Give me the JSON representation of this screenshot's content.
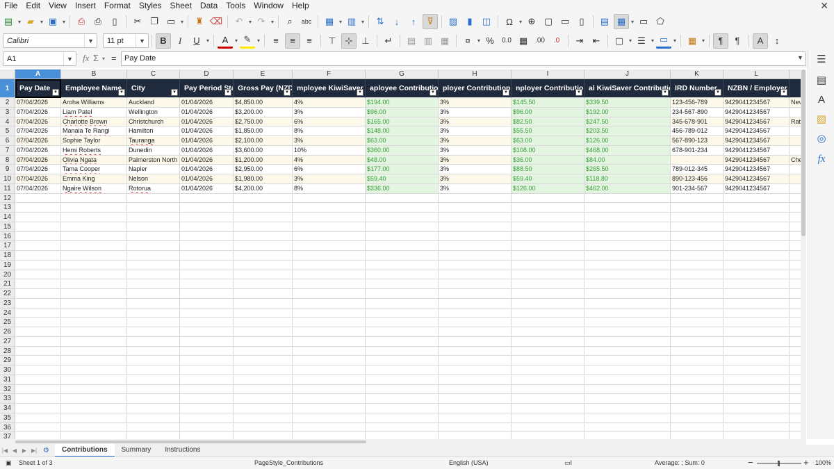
{
  "menu": [
    "File",
    "Edit",
    "View",
    "Insert",
    "Format",
    "Styles",
    "Sheet",
    "Data",
    "Tools",
    "Window",
    "Help"
  ],
  "font": {
    "name": "Calibri",
    "size": "11 pt"
  },
  "namebox": "A1",
  "formula": "Pay Date",
  "columns": [
    "A",
    "B",
    "C",
    "D",
    "E",
    "F",
    "G",
    "H",
    "I",
    "J",
    "K",
    "L"
  ],
  "headers": [
    "Pay Date",
    "Employee Name",
    "City",
    "Pay Period Start",
    "Gross Pay (NZD)",
    "mployee KiwiSaver Rate",
    "aployee Contribution (N",
    "ployer Contribution Rat",
    "nployer Contribution (N",
    "al KiwiSaver Contribution (N",
    "IRD Number",
    "NZBN / Employer ID"
  ],
  "rows": [
    [
      "07/04/2026",
      "Aroha Williams",
      "Auckland",
      "01/04/2026",
      "$4,850.00",
      "4%",
      "$194.00",
      "3%",
      "$145.50",
      "$339.50",
      "123-456-789",
      "9429041234567",
      "Nev"
    ],
    [
      "07/04/2026",
      "Liam Patel",
      "Wellington",
      "01/04/2026",
      "$3,200.00",
      "3%",
      "$96.00",
      "3%",
      "$96.00",
      "$192.00",
      "234-567-890",
      "9429041234567",
      ""
    ],
    [
      "07/04/2026",
      "Charlotte Brown",
      "Christchurch",
      "01/04/2026",
      "$2,750.00",
      "6%",
      "$165.00",
      "3%",
      "$82.50",
      "$247.50",
      "345-678-901",
      "9429041234567",
      "Rate"
    ],
    [
      "07/04/2026",
      "Manaia Te Rangi",
      "Hamilton",
      "01/04/2026",
      "$1,850.00",
      "8%",
      "$148.00",
      "3%",
      "$55.50",
      "$203.50",
      "456-789-012",
      "9429041234567",
      ""
    ],
    [
      "07/04/2026",
      "Sophie Taylor",
      "Tauranga",
      "01/04/2026",
      "$2,100.00",
      "3%",
      "$63.00",
      "3%",
      "$63.00",
      "$126.00",
      "567-890-123",
      "9429041234567",
      ""
    ],
    [
      "07/04/2026",
      "Hemi Roberts",
      "Dunedin",
      "01/04/2026",
      "$3,600.00",
      "10%",
      "$360.00",
      "3%",
      "$108.00",
      "$468.00",
      "678-901-234",
      "9429041234567",
      ""
    ],
    [
      "07/04/2026",
      "Olivia Ngata",
      "Palmerston North",
      "01/04/2026",
      "$1,200.00",
      "4%",
      "$48.00",
      "3%",
      "$36.00",
      "$84.00",
      "",
      "9429041234567",
      "Che"
    ],
    [
      "07/04/2026",
      "Tama Cooper",
      "Napier",
      "01/04/2026",
      "$2,950.00",
      "6%",
      "$177.00",
      "3%",
      "$88.50",
      "$265.50",
      "789-012-345",
      "9429041234567",
      ""
    ],
    [
      "07/04/2026",
      "Emma King",
      "Nelson",
      "01/04/2026",
      "$1,980.00",
      "3%",
      "$59.40",
      "3%",
      "$59.40",
      "$118.80",
      "890-123-456",
      "9429041234567",
      ""
    ],
    [
      "07/04/2026",
      "Ngaire Wilson",
      "Rotorua",
      "01/04/2026",
      "$4,200.00",
      "8%",
      "$336.00",
      "3%",
      "$126.00",
      "$462.00",
      "901-234-567",
      "9429041234567",
      ""
    ]
  ],
  "empty_row_numbers": [
    "12",
    "13",
    "14",
    "15",
    "16",
    "17",
    "18",
    "19",
    "20",
    "21",
    "22",
    "23",
    "24",
    "25",
    "26",
    "27",
    "28",
    "29",
    "30",
    "31",
    "32",
    "33",
    "34",
    "35",
    "36",
    "37"
  ],
  "sheets": [
    "Contributions",
    "Summary",
    "Instructions"
  ],
  "status": {
    "sheet": "Sheet 1 of 3",
    "page_style": "PageStyle_Contributions",
    "language": "English (USA)",
    "sum": "Average: ; Sum: 0",
    "zoom": "100%"
  },
  "colors": {
    "header_bg": "#1f2a3c",
    "band": "#fdf9ea",
    "green_cell": "#e3f4e1",
    "selected": "#4a90d9"
  }
}
